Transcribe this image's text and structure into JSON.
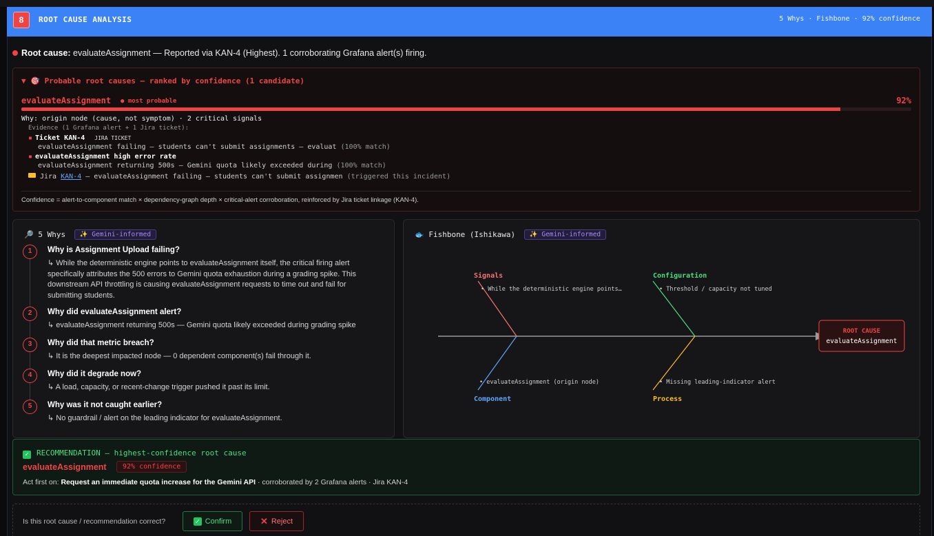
{
  "header": {
    "step_number": "8",
    "title": "ROOT CAUSE ANALYSIS",
    "meta": "5 Whys · Fishbone · 92% confidence"
  },
  "root_cause": {
    "label": "Root cause:",
    "component": "evaluateAssignment",
    "detail": "— Reported via KAN-4 (Highest). 1 corroborating Grafana alert(s) firing."
  },
  "probable": {
    "title": "▼ 🎯 Probable root causes — ranked by confidence (1 candidate)",
    "candidate": {
      "name": "evaluateAssignment",
      "tag": "● most probable",
      "confidence_label": "92%",
      "confidence": 0.92
    },
    "why": "Why: origin node (cause, not symptom) · 2 critical signals",
    "evidence_header": "Evidence (1 Grafana alert + 1 Jira ticket):",
    "evidence": [
      {
        "title": "Ticket KAN-4",
        "badge": "JIRA TICKET",
        "desc": "evaluateAssignment failing — students can't submit assignments — evaluat",
        "match": "(100% match)"
      },
      {
        "title": "evaluateAssignment high error rate",
        "badge": "",
        "desc": "evaluateAssignment returning 500s — Gemini quota likely exceeded during",
        "match": "(100% match)"
      }
    ],
    "jira": {
      "prefix": "Jira",
      "link": "KAN-4",
      "text": "— evaluateAssignment failing — students can't submit assignmen",
      "note": "(triggered this incident)"
    },
    "confidence_note": "Confidence = alert-to-component match × dependency-graph depth × critical-alert corroboration, reinforced by Jira ticket linkage (KAN-4)."
  },
  "whys": {
    "title": "5 Whys",
    "badge": "✨ Gemini-informed",
    "items": [
      {
        "num": "1",
        "q": "Why is Assignment Upload failing?",
        "a": "↳ While the deterministic engine points to evaluateAssignment itself, the critical firing alert specifically attributes the 500 errors to Gemini quota exhaustion during a grading spike. This downstream API throttling is causing evaluateAssignment requests to time out and fail for submitting students."
      },
      {
        "num": "2",
        "q": "Why did evaluateAssignment alert?",
        "a": "↳ evaluateAssignment returning 500s — Gemini quota likely exceeded during grading spike"
      },
      {
        "num": "3",
        "q": "Why did that metric breach?",
        "a": "↳ It is the deepest impacted node — 0 dependent component(s) fail through it."
      },
      {
        "num": "4",
        "q": "Why did it degrade now?",
        "a": "↳ A load, capacity, or recent-change trigger pushed it past its limit."
      },
      {
        "num": "5",
        "q": "Why was it not caught earlier?",
        "a": "↳ No guardrail / alert on the leading indicator for evaluateAssignment."
      }
    ]
  },
  "fishbone": {
    "title": "Fishbone (Ishikawa)",
    "badge": "✨ Gemini-informed",
    "head_label": "ROOT CAUSE",
    "head_value": "evaluateAssignment",
    "categories": {
      "signals": {
        "name": "Signals",
        "cause": "• While the deterministic engine points…",
        "color": "#f87171"
      },
      "configuration": {
        "name": "Configuration",
        "cause": "• Threshold / capacity not tuned",
        "color": "#4ade80"
      },
      "component": {
        "name": "Component",
        "cause": "• evaluateAssignment (origin node)",
        "color": "#60a5fa"
      },
      "process": {
        "name": "Process",
        "cause": "• Missing leading-indicator alert",
        "color": "#fbbf24"
      }
    }
  },
  "recommendation": {
    "title": "RECOMMENDATION — highest-confidence root cause",
    "component": "evaluateAssignment",
    "confidence": "92% confidence",
    "act_prefix": "Act first on:",
    "act_action": "Request an immediate quota increase for the Gemini API",
    "act_suffix": "· corroborated by 2 Grafana alerts · Jira KAN-4"
  },
  "feedback": {
    "question": "Is this root cause / recommendation correct?",
    "confirm_label": "Confirm",
    "reject_label": "Reject"
  }
}
